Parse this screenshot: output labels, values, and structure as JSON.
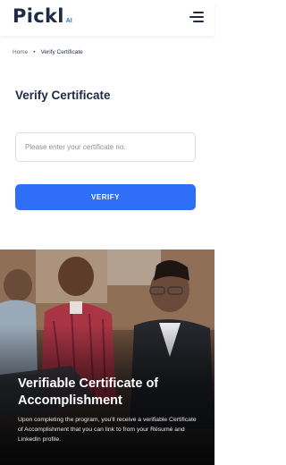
{
  "header": {
    "logo_text": "Pickl",
    "logo_suffix": "AI",
    "menu_icon": "hamburger-menu-icon"
  },
  "breadcrumb": {
    "home": "Home",
    "separator": "•",
    "current": "Verify Certificate"
  },
  "page_title": "Verify Certificate",
  "form": {
    "certificate_input": {
      "placeholder": "Please enter your certificate no.",
      "value": ""
    },
    "verify_button": "VERIFY"
  },
  "hero": {
    "title": "Verifiable Certificate of Accomplishment",
    "description": "Upon completing the program, you'll receive a verifiable Certificate of Accomplishment that you can link to from your Résumé and LinkedIn profile."
  },
  "colors": {
    "brand_blue": "#2f6ef7",
    "text_dark": "#1f2a44"
  }
}
